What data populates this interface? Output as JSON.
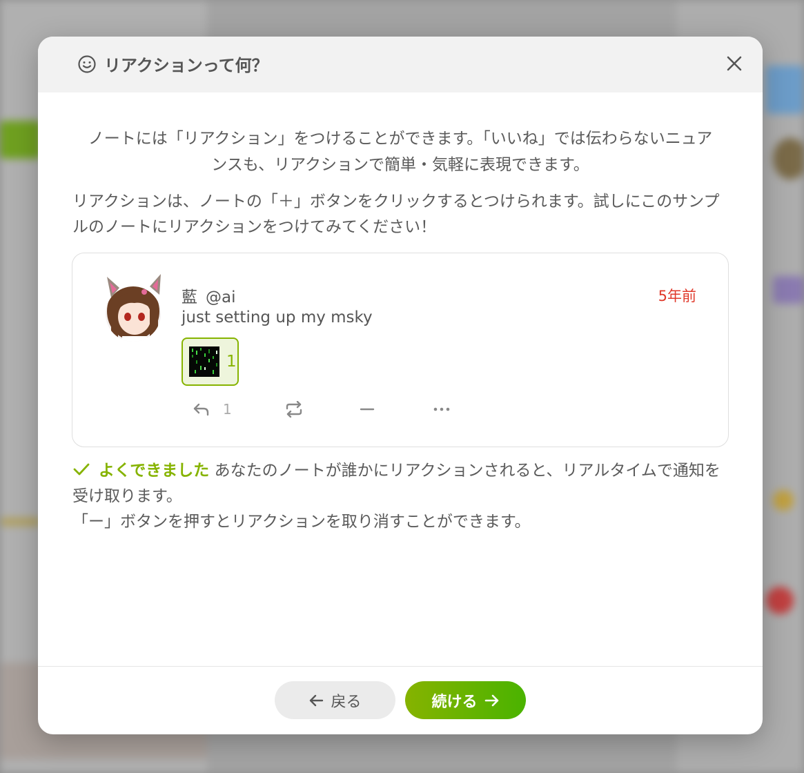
{
  "dialog": {
    "title": "リアクションって何？",
    "icon": "smile-icon",
    "close_icon": "close-icon"
  },
  "body": {
    "intro": "ノートには「リアクション」をつけることができます。「いいね」では伝わらないニュアンスも、リアクションで簡単・気軽に表現できます。",
    "instruction": "リアクションは、ノートの「＋」ボタンをクリックするとつけられます。試しにこのサンプルのノートにリアクションをつけてみてください！"
  },
  "note": {
    "display_name": "藍",
    "username": "@ai",
    "time": "5年前",
    "text": "just setting up my msky",
    "reaction": {
      "emoji": "matrix-emoji",
      "count": "1"
    },
    "actions": {
      "reply_icon": "reply-icon",
      "reply_count": "1",
      "renote_icon": "renote-icon",
      "unreact_icon": "minus-icon",
      "more_icon": "more-icon"
    }
  },
  "success": {
    "icon": "check-icon",
    "done_label": "よくできました",
    "line1": " あなたのノートが誰かにリアクションされると、リアルタイムで通知を受け取ります。",
    "line2": "「ー」ボタンを押すとリアクションを取り消すことができます。"
  },
  "footer": {
    "back_label": "戻る",
    "next_label": "続ける"
  },
  "colors": {
    "accent": "#86b300",
    "accent2": "#4ab300",
    "time": "#e0392b"
  }
}
